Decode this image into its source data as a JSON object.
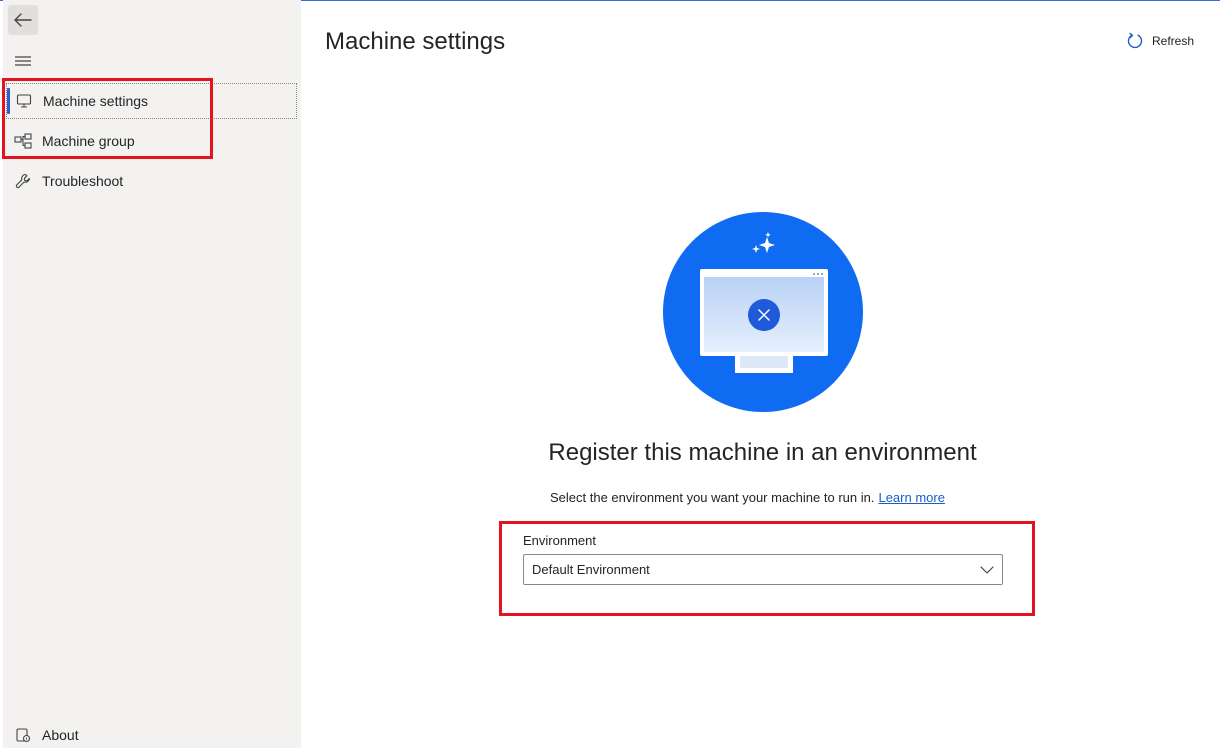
{
  "sidebar": {
    "items": [
      {
        "label": "Machine settings",
        "icon": "monitor-icon",
        "selected": true
      },
      {
        "label": "Machine group",
        "icon": "machine-group-icon",
        "selected": false
      },
      {
        "label": "Troubleshoot",
        "icon": "wrench-icon",
        "selected": false
      }
    ],
    "about_label": "About"
  },
  "header": {
    "title": "Machine settings",
    "refresh_label": "Refresh"
  },
  "main": {
    "heading": "Register this machine in an environment",
    "description": "Select the environment you want your machine to run in.",
    "learn_more": "Learn more",
    "environment": {
      "label": "Environment",
      "value": "Default Environment"
    }
  },
  "colors": {
    "accent": "#0f6cf2",
    "highlight_box": "#e3141f",
    "link": "#1c5ec7"
  }
}
